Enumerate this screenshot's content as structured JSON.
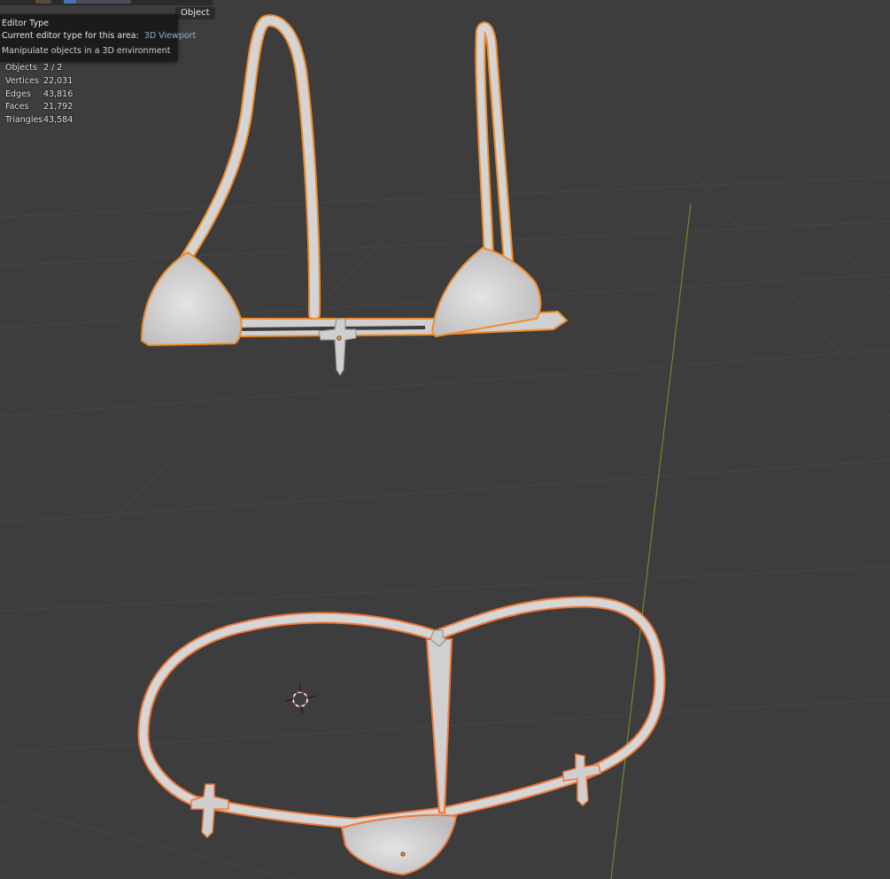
{
  "mode_label": "Object",
  "tooltip": {
    "title": "Editor Type",
    "current_label": "Current editor type for this area:",
    "current_value": "3D Viewport",
    "description": "Manipulate objects in a 3D environment"
  },
  "stats": {
    "rows": [
      {
        "label": "Objects",
        "value": "2 / 2"
      },
      {
        "label": "Vertices",
        "value": "22,031"
      },
      {
        "label": "Edges",
        "value": "43,816"
      },
      {
        "label": "Faces",
        "value": "21,792"
      },
      {
        "label": "Triangles",
        "value": "43,584"
      }
    ]
  },
  "colors": {
    "background": "#3d3d3d",
    "grid": "#474747",
    "y_axis": "#6a8d2c",
    "selection_outline": "#f08c2c",
    "active_outline": "#f07838",
    "mesh": "#cfcfcf"
  },
  "icons": {
    "cursor": "3d-cursor-icon",
    "origin": "object-origin-icon"
  }
}
